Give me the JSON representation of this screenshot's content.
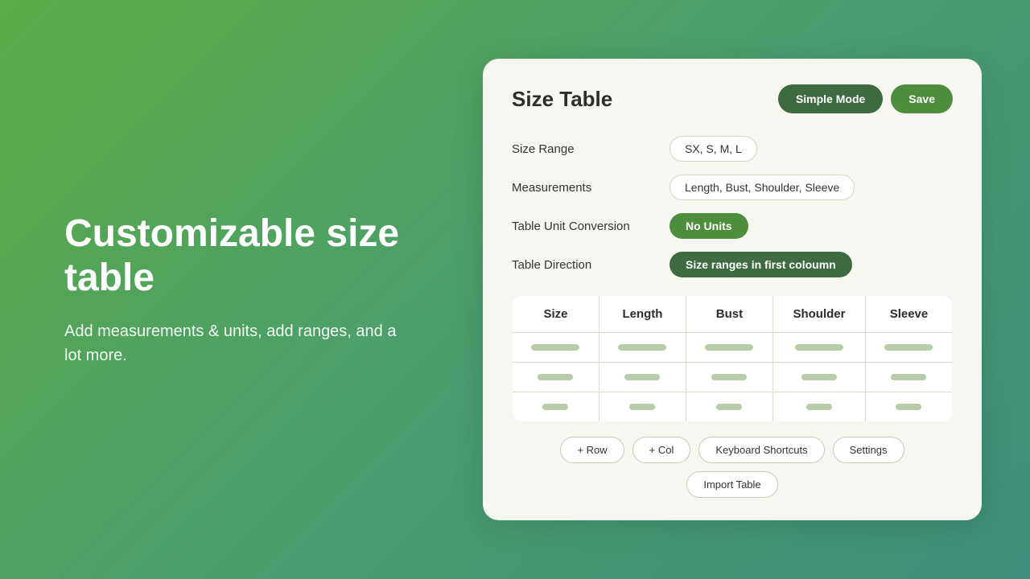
{
  "left": {
    "headline": "Customizable size table",
    "description": "Add measurements & units, add ranges, and a lot more."
  },
  "card": {
    "title": "Size Table",
    "buttons": {
      "simple_mode": "Simple Mode",
      "save": "Save"
    },
    "settings": [
      {
        "id": "size-range",
        "label": "Size Range",
        "value": "SX, S, M, L",
        "style": "pill-outline"
      },
      {
        "id": "measurements",
        "label": "Measurements",
        "value": "Length, Bust, Shoulder, Sleeve",
        "style": "pill-outline"
      },
      {
        "id": "table-unit-conversion",
        "label": "Table Unit Conversion",
        "value": "No Units",
        "style": "pill-green"
      },
      {
        "id": "table-direction",
        "label": "Table Direction",
        "value": "Size ranges in first coloumn",
        "style": "pill-dark"
      }
    ],
    "table": {
      "headers": [
        "Size",
        "Length",
        "Bust",
        "Shoulder",
        "Sleeve"
      ],
      "rows": [
        [
          "long",
          "long",
          "long",
          "long",
          "long"
        ],
        [
          "medium",
          "medium",
          "medium",
          "medium",
          "medium"
        ],
        [
          "short",
          "short",
          "short",
          "short",
          "short"
        ]
      ]
    },
    "bottom_buttons": [
      "+ Row",
      "+ Col",
      "Keyboard Shortcuts",
      "Settings",
      "Import Table"
    ]
  }
}
